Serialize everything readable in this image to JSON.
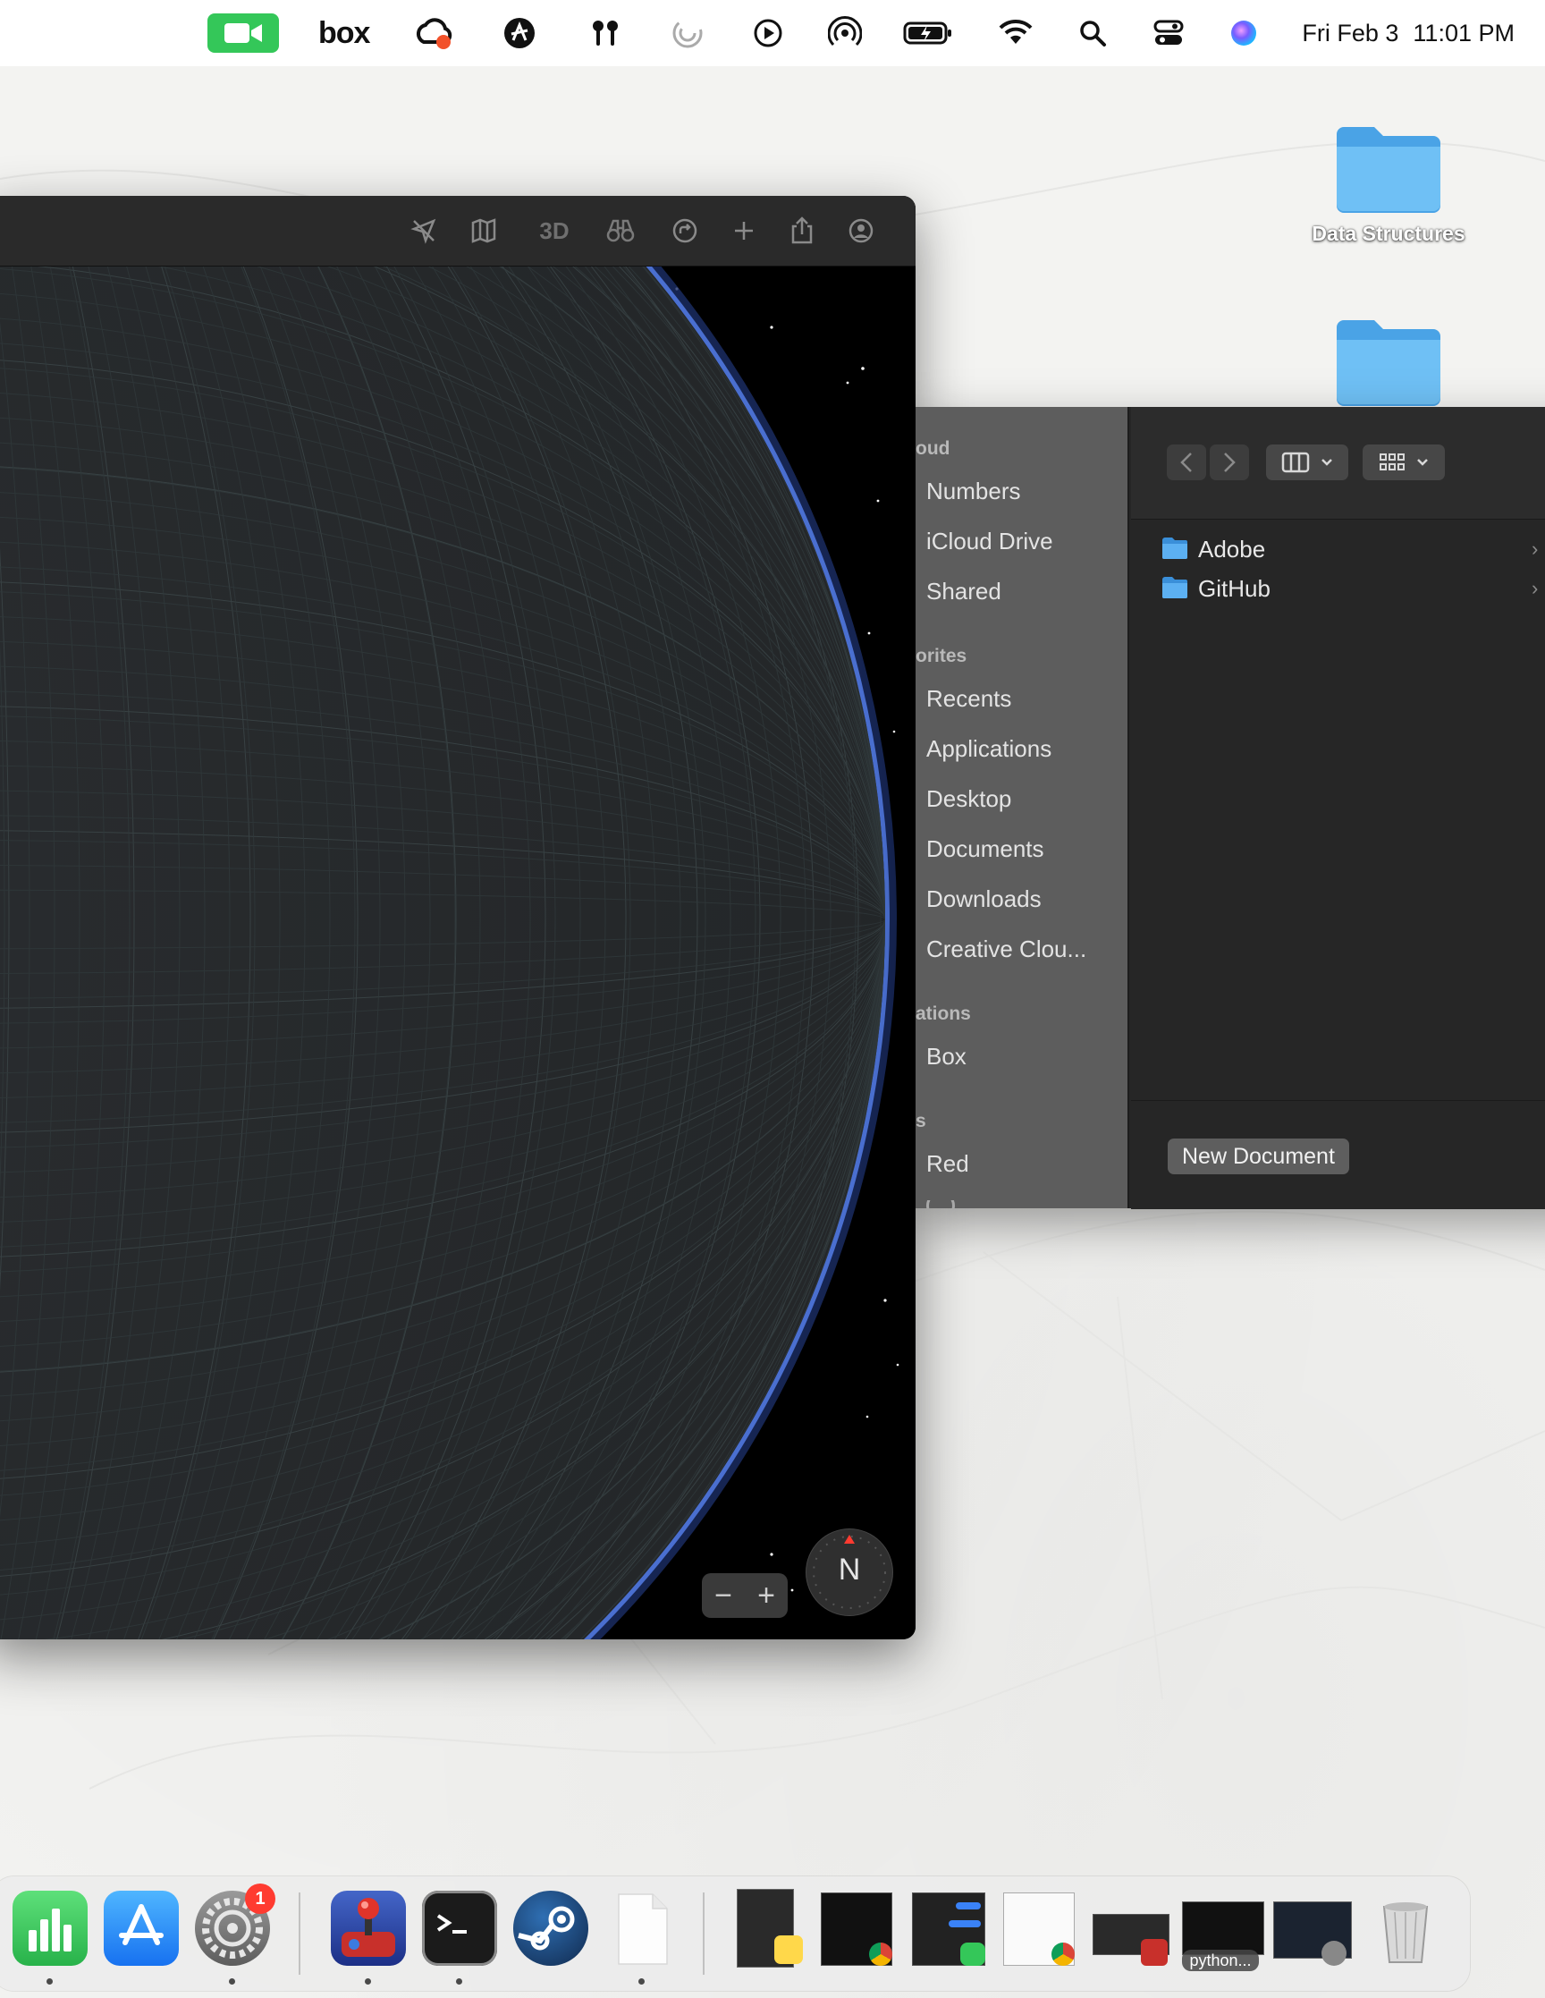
{
  "menubar": {
    "date": "Fri Feb 3",
    "time": "11:01 PM",
    "box_label": "box",
    "icons": [
      "facetime-icon",
      "box-icon",
      "creative-cloud-icon",
      "vpn-icon",
      "airpods-icon",
      "focus-icon",
      "play-icon",
      "airdrop-icon",
      "battery-icon",
      "wifi-icon",
      "spotlight-icon",
      "control-center-icon",
      "siri-icon"
    ]
  },
  "desktop": {
    "folders": [
      {
        "label": "Data Structures"
      },
      {
        "label": ""
      }
    ]
  },
  "maps": {
    "toolbar_3d": "3D",
    "compass_label": "N",
    "zoom_out": "−",
    "zoom_in": "+"
  },
  "finder": {
    "sidebar": {
      "sections": [
        {
          "title": "oud",
          "items": [
            "Numbers",
            "iCloud Drive",
            "Shared"
          ]
        },
        {
          "title": "orites",
          "items": [
            "Recents",
            "Applications",
            "Desktop",
            "Documents",
            "Downloads",
            "Creative Clou..."
          ]
        },
        {
          "title": "ations",
          "items": [
            "Box"
          ]
        },
        {
          "title": "s",
          "items": [
            "Red"
          ]
        }
      ]
    },
    "files": [
      {
        "name": "Adobe"
      },
      {
        "name": "GitHub"
      }
    ],
    "new_document_label": "New Document"
  },
  "dock": {
    "settings_badge": "1",
    "python_label": "python...",
    "colors": {
      "numbers": "#34c759",
      "appstore": "#1f8efa",
      "terminal": "#1b1b1b",
      "steam": "#1b3e6b",
      "badge": "#ff3b30"
    }
  }
}
